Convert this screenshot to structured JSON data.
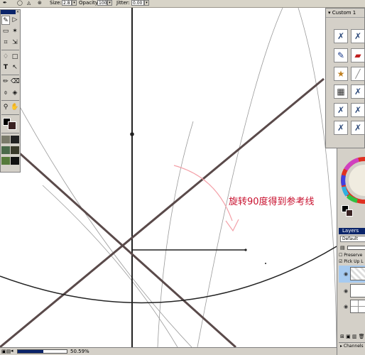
{
  "options_bar": {
    "size_label": "Size:",
    "size_value": "2.8",
    "opacity_label": "Opacity:",
    "opacity_value": "100",
    "jitter_label": "Jitter:",
    "jitter_value": "0.00"
  },
  "canvas": {
    "annotation": "旋转90度得到参考线",
    "annotation_color": "#c8102e",
    "arrow_color": "#f4a0a8",
    "line_color": "#5a4a4a"
  },
  "custom_panel": {
    "title": "Custom 1"
  },
  "layers_panel": {
    "tab_label": "Layers",
    "blend_mode": "Default",
    "preserve_label": "Preserve",
    "pickup_label": "Pick Up L",
    "channels_label": "Channels"
  },
  "status_bar": {
    "zoom_value": "50.59%",
    "zoom_level": 0.52
  },
  "colors": {
    "foreground": "#000000",
    "background": "#3a2222",
    "title_blue": "#0a246a"
  }
}
